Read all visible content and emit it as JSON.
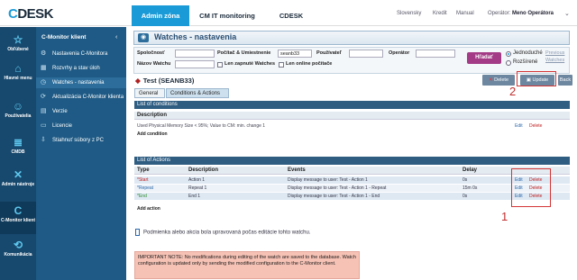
{
  "topbar": {
    "logo": "CDESK",
    "nav": [
      "Admin zóna",
      "CM IT monitoring",
      "CDESK"
    ],
    "right": [
      "Slovensky",
      "Kredit",
      "Manual"
    ],
    "operator_label": "Operátor:",
    "operator_name": "Meno Operátora"
  },
  "sidebar": {
    "items": [
      {
        "label": "Obľúbené",
        "icon": "star-icon"
      },
      {
        "label": "Hlavné menu",
        "icon": "home-icon"
      },
      {
        "label": "Používatelia",
        "icon": "users-icon"
      },
      {
        "label": "CMDB",
        "icon": "database-icon"
      },
      {
        "label": "Admin nástroje",
        "icon": "tools-icon"
      },
      {
        "label": "C-Monitor klient",
        "icon": "cmonitor-icon"
      },
      {
        "label": "Komunikácia",
        "icon": "communication-icon"
      }
    ]
  },
  "submenu": {
    "title": "C-Monitor klient",
    "items": [
      "Nastavenia C-Monitora",
      "Rozvrhy a stav úloh",
      "Watches - nastavenia",
      "Aktualizácia C-Monitor klienta",
      "Verzie",
      "Licencie",
      "Stiahnuť súbory z PC"
    ]
  },
  "page": {
    "title": "Watches - nastavenia"
  },
  "filters": {
    "company_label": "Spoločnosť",
    "computer_label": "Počítač & Umiestnenie",
    "computer_value": "seanb33",
    "user_label": "Používateľ",
    "operator_label": "Operátor",
    "watch_name_label": "Názov Watchu",
    "only_enabled_label": "Len zapnuté Watches",
    "only_online_label": "Len online počítače",
    "search_button": "Hľadať",
    "simple_label": "Jednoduché",
    "advanced_label": "Rozšírené",
    "previous_label": "Previous",
    "watches_label": "Watches"
  },
  "watch": {
    "name": "Test (SEANB33)",
    "delete_button": "Delete",
    "update_button": "Update",
    "back_button": "Back"
  },
  "tabs": [
    "General",
    "Conditions & Actions"
  ],
  "conditions": {
    "header": "List of conditions",
    "col_description": "Description",
    "rows": [
      {
        "description": "Used Physical Memory Size < 95%; Value to CM: min. change 1",
        "edit": "Edit",
        "delete": "Delete"
      }
    ],
    "add_label": "Add condition"
  },
  "actions": {
    "header": "List of Actions",
    "columns": [
      "Type",
      "Description",
      "Events",
      "Delay"
    ],
    "rows": [
      {
        "type": "Start",
        "description": "Action 1",
        "events": "Display message to user: Test - Action 1",
        "delay": "0s",
        "edit": "Edit",
        "delete": "Delete"
      },
      {
        "type": "Repeat",
        "description": "Repeat 1",
        "events": "Display message to user: Test - Action 1 - Repeat",
        "delay": "15m 0s",
        "edit": "Edit",
        "delete": "Delete"
      },
      {
        "type": "End",
        "description": "End 1",
        "events": "Display message to user: Test - Action 1 - End",
        "delay": "0s",
        "edit": "Edit",
        "delete": "Delete"
      }
    ],
    "add_label": "Add action"
  },
  "legend_text": "Podmienka alebo akcia bola upravovaná počas editácie tohto watchu.",
  "note": "IMPORTANT NOTE: No modifications during editing of the watch are saved to the database. Watch configuration is updated only by sending the modified configuration to the C-Monitor client.",
  "annotations": {
    "one": "1",
    "two": "2"
  },
  "colors": {
    "accent": "#1a9bd8",
    "sidebar": "#17486d",
    "search": "#a33b86",
    "annotation": "#d43535"
  }
}
